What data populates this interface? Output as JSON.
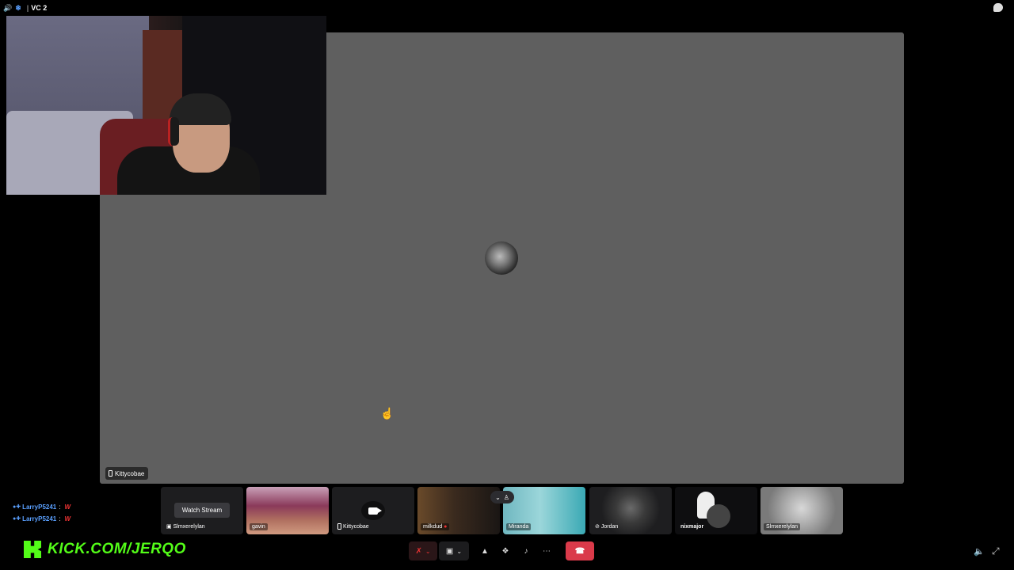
{
  "topbar": {
    "channel_name": "VC 2"
  },
  "stage": {
    "speaker_label": "Kittycobae"
  },
  "participants": [
    {
      "name": "Slmxerelylan",
      "kind": "stream",
      "button_label": "Watch Stream"
    },
    {
      "name": "gavin",
      "kind": "video"
    },
    {
      "name": "Kittycobae",
      "kind": "camera-off"
    },
    {
      "name": "milkdud",
      "kind": "video"
    },
    {
      "name": "Miranda",
      "kind": "video"
    },
    {
      "name": "Jordan",
      "kind": "avatar"
    },
    {
      "name": "nixmajor",
      "kind": "avatar"
    },
    {
      "name": "Slmxerelylan",
      "kind": "avatar"
    }
  ],
  "chat": {
    "messages": [
      {
        "user": "LarryP5241",
        "text": "W"
      },
      {
        "user": "LarryP5241",
        "text": "W"
      }
    ]
  },
  "watermark": {
    "text": "KICK.COM/JERQO",
    "logo_letter": "K"
  },
  "colors": {
    "stage_bg": "#5f5f5f",
    "end_call": "#da3a4a",
    "kick_green": "#53fc18",
    "chat_user": "#5aa0ff"
  }
}
